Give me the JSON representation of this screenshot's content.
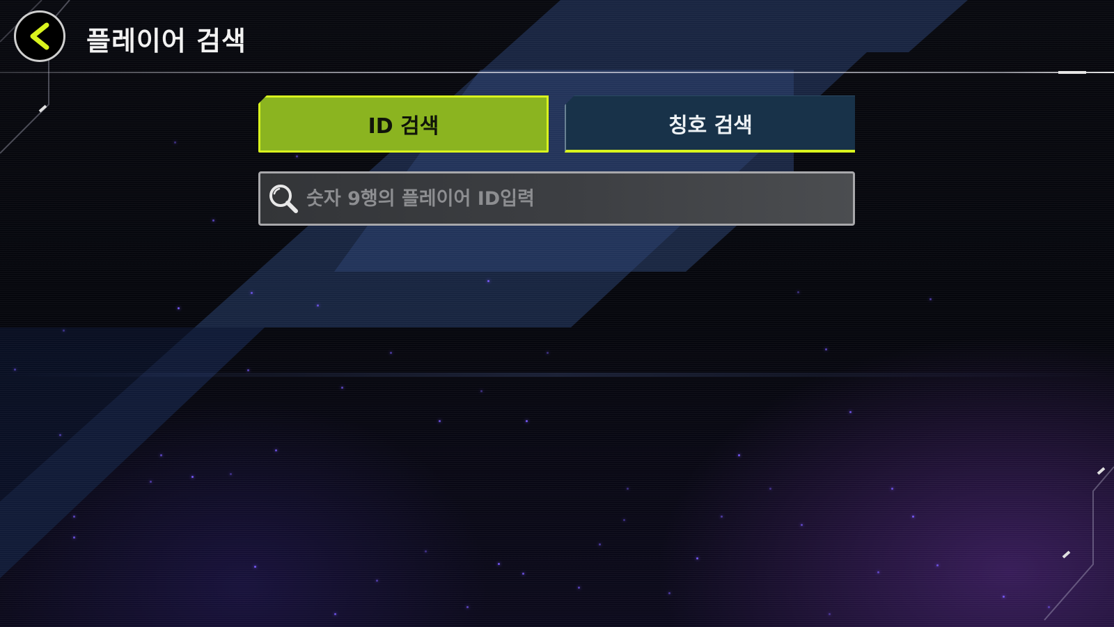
{
  "header": {
    "title": "플레이어 검색",
    "back_icon": "chevron-left-icon"
  },
  "tabs": [
    {
      "label": "ID 검색",
      "active": true
    },
    {
      "label": "칭호 검색",
      "active": false
    }
  ],
  "search": {
    "placeholder": "숫자 9행의 플레이어 ID입력",
    "value": "",
    "icon": "search-icon"
  },
  "colors": {
    "accent": "#d9f31e",
    "active_tab": "#8bb420",
    "inactive_tab": "#183249",
    "particle": "#7b5cff"
  }
}
